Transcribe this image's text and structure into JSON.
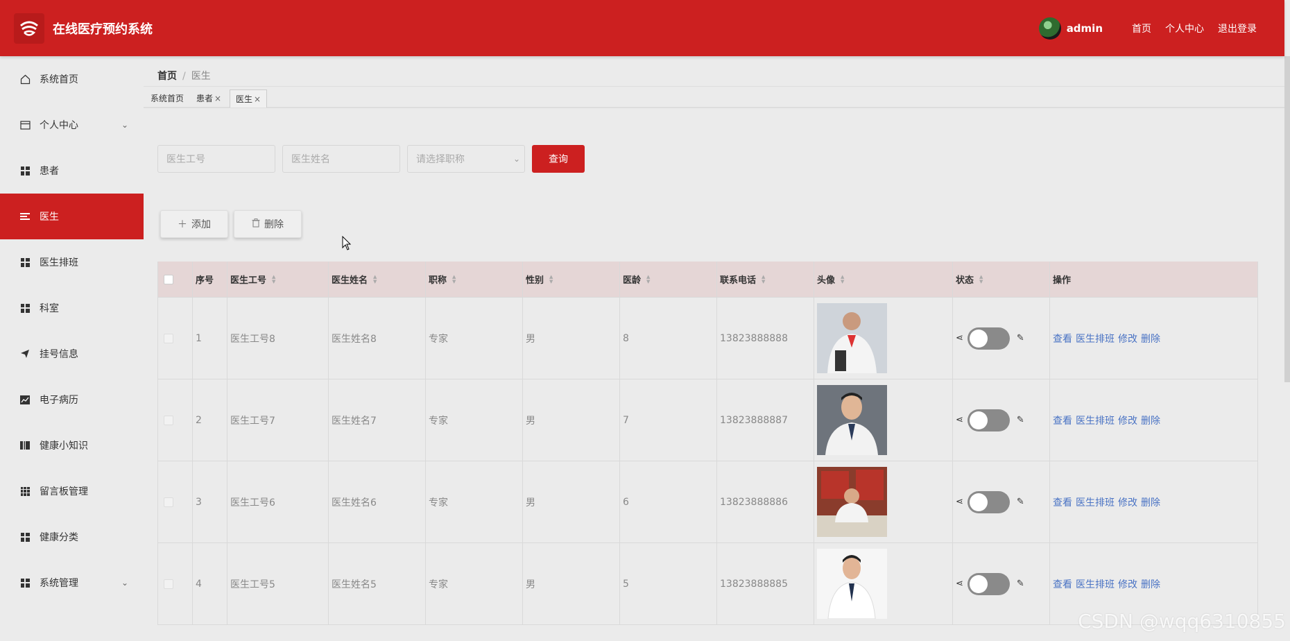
{
  "header": {
    "app_title": "在线医疗预约系统",
    "user": "admin",
    "links": [
      "首页",
      "个人中心",
      "退出登录"
    ]
  },
  "sidebar": {
    "items": [
      {
        "label": "系统首页",
        "icon": "home-icon"
      },
      {
        "label": "个人中心",
        "icon": "card-icon"
      },
      {
        "label": "患者",
        "icon": "grid-icon"
      },
      {
        "label": "医生",
        "icon": "menu-icon"
      },
      {
        "label": "医生排班",
        "icon": "grid-icon"
      },
      {
        "label": "科室",
        "icon": "grid-icon"
      },
      {
        "label": "挂号信息",
        "icon": "send-icon"
      },
      {
        "label": "电子病历",
        "icon": "chart-icon"
      },
      {
        "label": "健康小知识",
        "icon": "book-icon"
      },
      {
        "label": "留言板管理",
        "icon": "grid9-icon"
      },
      {
        "label": "健康分类",
        "icon": "grid-icon"
      },
      {
        "label": "系统管理",
        "icon": "grid-icon"
      }
    ]
  },
  "breadcrumb": {
    "home": "首页",
    "sep": "/",
    "current": "医生"
  },
  "tabs": [
    {
      "label": "系统首页"
    },
    {
      "label": "患者",
      "close": "×"
    },
    {
      "label": "医生",
      "close": "×"
    }
  ],
  "search": {
    "doctor_id_placeholder": "医生工号",
    "doctor_name_placeholder": "医生姓名",
    "title_placeholder": "请选择职称",
    "query_label": "查询"
  },
  "actions": {
    "add_label": "添加",
    "delete_label": "删除"
  },
  "table": {
    "headers": [
      "序号",
      "医生工号",
      "医生姓名",
      "职称",
      "性别",
      "医龄",
      "联系电话",
      "头像",
      "状态",
      "操作"
    ],
    "rows": [
      {
        "no": "1",
        "id": "医生工号8",
        "name": "医生姓名8",
        "title": "专家",
        "gender": "男",
        "years": "8",
        "phone": "13823888888"
      },
      {
        "no": "2",
        "id": "医生工号7",
        "name": "医生姓名7",
        "title": "专家",
        "gender": "男",
        "years": "7",
        "phone": "13823888887"
      },
      {
        "no": "3",
        "id": "医生工号6",
        "name": "医生姓名6",
        "title": "专家",
        "gender": "男",
        "years": "6",
        "phone": "13823888886"
      },
      {
        "no": "4",
        "id": "医生工号5",
        "name": "医生姓名5",
        "title": "专家",
        "gender": "男",
        "years": "5",
        "phone": "13823888885"
      }
    ],
    "ops": [
      "查看",
      "医生排班",
      "修改",
      "删除"
    ]
  },
  "watermark": "CSDN @wqq6310855",
  "colors": {
    "primary": "#cc2020",
    "link": "#4a73c4",
    "header_row": "#e5d6d6"
  }
}
